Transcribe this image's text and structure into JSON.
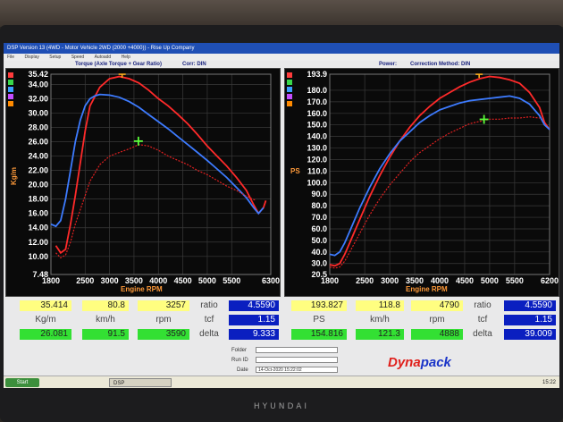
{
  "window": {
    "title": "DSP Version 13 (4WD - Motor Vehicle 2WD (2000 +4000)) - Rise Up Company",
    "menu": [
      "File",
      "Display",
      "Setup",
      "Speed",
      "Autoadd",
      "Help"
    ]
  },
  "colors": {
    "run1": "#ff2a2a",
    "run2": "#3d7bff",
    "run3": "#e02020",
    "marker": "#5cff3a",
    "peak_marker": "#ffb020",
    "value_yellow": "#fffe80",
    "value_green": "#33e033",
    "value_blue": "#0a1fc0",
    "dynapack_red": "#e0201c",
    "dynapack_blue": "#1a34c8"
  },
  "left_panel": {
    "header": "Torque (Axle Torque + Gear Ratio)",
    "correction": "Corr: DIN",
    "ylabel": "Kg/m",
    "xlabel": "Engine RPM",
    "swatch_colors": [
      "#ff3c3c",
      "#38d84a",
      "#3aa0ff",
      "#c44dff",
      "#ff8a00"
    ]
  },
  "right_panel": {
    "header": "Power:",
    "correction": "Correction Method: DIN",
    "ylabel": "PS",
    "xlabel": "Engine RPM",
    "swatch_colors": [
      "#ff3c3c",
      "#38d84a",
      "#3aa0ff",
      "#c44dff",
      "#ff8a00"
    ]
  },
  "chart_data": [
    {
      "type": "line",
      "title": "Torque (Axle Torque + Gear Ratio)",
      "xlabel": "Engine RPM",
      "ylabel": "Kg/m",
      "xlim": [
        1800,
        6300
      ],
      "ylim": [
        7.48,
        35.42
      ],
      "x_ticks": [
        "1800",
        "2500",
        "3000",
        "3500",
        "4000",
        "4500",
        "5000",
        "5500",
        "6300"
      ],
      "y_ticks": [
        "35.42",
        "34.00",
        "32.00",
        "30.00",
        "28.00",
        "26.00",
        "24.00",
        "22.00",
        "20.00",
        "18.00",
        "16.00",
        "14.00",
        "12.00",
        "10.00",
        "7.48"
      ],
      "grid": true,
      "series": [
        {
          "color": "#ff2a2a",
          "x": [
            1900,
            2000,
            2100,
            2200,
            2300,
            2400,
            2500,
            2600,
            2800,
            3000,
            3200,
            3400,
            3600,
            3800,
            4000,
            4200,
            4400,
            4600,
            4800,
            5000,
            5200,
            5400,
            5600,
            5800,
            5950,
            6050,
            6150,
            6200
          ],
          "y": [
            11.5,
            10.5,
            11.0,
            14.5,
            18.5,
            23.0,
            27.5,
            31.0,
            33.6,
            34.8,
            35.1,
            34.8,
            34.2,
            33.2,
            32.0,
            31.0,
            29.8,
            28.5,
            27.0,
            25.4,
            24.0,
            22.6,
            21.0,
            19.2,
            17.2,
            16.0,
            16.8,
            17.8
          ]
        },
        {
          "color": "#3d7bff",
          "x": [
            1800,
            1900,
            2000,
            2100,
            2200,
            2300,
            2400,
            2500,
            2600,
            2700,
            2800,
            3000,
            3200,
            3400,
            3600,
            3800,
            4000,
            4200,
            4400,
            4600,
            4800,
            5000,
            5200,
            5400,
            5600,
            5800,
            5950,
            6050,
            6150
          ],
          "y": [
            14.5,
            14.2,
            15.0,
            18.0,
            22.0,
            26.0,
            29.0,
            31.0,
            32.0,
            32.4,
            32.6,
            32.5,
            32.2,
            31.6,
            30.8,
            29.8,
            28.8,
            27.8,
            26.7,
            25.6,
            24.5,
            23.4,
            22.2,
            21.0,
            19.6,
            18.2,
            16.8,
            16.0,
            16.8
          ]
        },
        {
          "color": "#e02020",
          "x": [
            1900,
            2000,
            2100,
            2200,
            2300,
            2400,
            2500,
            2600,
            2800,
            3000,
            3200,
            3400,
            3600,
            3800,
            4000,
            4200,
            4400,
            4600,
            4800,
            5000,
            5200,
            5400,
            5600,
            5800,
            6000
          ],
          "y": [
            10.5,
            9.8,
            10.2,
            12.0,
            14.5,
            16.5,
            18.5,
            20.5,
            22.8,
            24.0,
            24.5,
            25.0,
            25.6,
            25.4,
            24.8,
            24.0,
            23.4,
            22.8,
            22.0,
            21.4,
            20.6,
            19.8,
            19.2,
            18.4,
            17.8
          ]
        }
      ],
      "markers": [
        {
          "kind": "cross",
          "x": 3590,
          "y": 26.081,
          "color": "#5cff3a"
        },
        {
          "kind": "peak",
          "x": 3257,
          "y": 35.414,
          "color": "#ffb020"
        }
      ]
    },
    {
      "type": "line",
      "title": "Power:",
      "xlabel": "Engine RPM",
      "ylabel": "PS",
      "xlim": [
        1800,
        6200
      ],
      "ylim": [
        20.5,
        193.9
      ],
      "x_ticks": [
        "1800",
        "2500",
        "3000",
        "3500",
        "4000",
        "4500",
        "5000",
        "5500",
        "6200"
      ],
      "y_ticks": [
        "193.9",
        "180.0",
        "170.0",
        "160.0",
        "150.0",
        "140.0",
        "130.0",
        "120.0",
        "110.0",
        "100.0",
        "90.0",
        "80.0",
        "70.0",
        "60.0",
        "50.0",
        "40.0",
        "30.0",
        "20.5"
      ],
      "grid": true,
      "series": [
        {
          "color": "#ff2a2a",
          "x": [
            1800,
            1900,
            2000,
            2100,
            2200,
            2400,
            2600,
            2800,
            3000,
            3200,
            3400,
            3600,
            3800,
            4000,
            4200,
            4400,
            4600,
            4800,
            5000,
            5200,
            5400,
            5600,
            5800,
            6000,
            6100,
            6200
          ],
          "y": [
            29,
            28,
            30,
            38,
            48,
            68,
            88,
            106,
            122,
            136,
            148,
            158,
            166,
            173,
            178,
            183,
            187,
            190,
            192,
            191,
            189,
            186,
            178,
            165,
            152,
            146
          ]
        },
        {
          "color": "#3d7bff",
          "x": [
            1800,
            1900,
            2000,
            2100,
            2200,
            2400,
            2600,
            2800,
            3000,
            3200,
            3400,
            3600,
            3800,
            4000,
            4200,
            4400,
            4600,
            4800,
            5000,
            5200,
            5400,
            5600,
            5800,
            6000,
            6100,
            6200
          ],
          "y": [
            38,
            37,
            40,
            48,
            58,
            78,
            96,
            112,
            125,
            136,
            144,
            152,
            158,
            163,
            166,
            169,
            171,
            172,
            173,
            174,
            175,
            173,
            168,
            158,
            150,
            146
          ]
        },
        {
          "color": "#e02020",
          "x": [
            1800,
            1900,
            2000,
            2100,
            2200,
            2400,
            2600,
            2800,
            3000,
            3200,
            3400,
            3600,
            3800,
            4000,
            4200,
            4400,
            4600,
            4800,
            5000,
            5200,
            5400,
            5600,
            5800,
            6000
          ],
          "y": [
            27,
            26,
            27,
            32,
            40,
            56,
            72,
            86,
            98,
            108,
            118,
            126,
            132,
            138,
            143,
            147,
            151,
            153,
            155,
            155,
            156,
            156,
            157,
            156
          ]
        }
      ],
      "markers": [
        {
          "kind": "cross",
          "x": 4888,
          "y": 154.816,
          "color": "#5cff3a"
        },
        {
          "kind": "peak",
          "x": 4790,
          "y": 193.827,
          "color": "#ffb020"
        }
      ]
    }
  ],
  "readouts": {
    "left": {
      "row1": {
        "value": "35.414",
        "speed": "80.8",
        "rpm": "3257",
        "ratio_label": "ratio",
        "ratio": "4.5590"
      },
      "labels": {
        "unit": "Kg/m",
        "speed": "km/h",
        "rpm": "rpm",
        "tcf_label": "tcf",
        "tcf": "1.15"
      },
      "row3": {
        "value": "26.081",
        "speed": "91.5",
        "rpm": "3590",
        "delta_label": "delta",
        "delta": "9.333"
      }
    },
    "right": {
      "row1": {
        "value": "193.827",
        "speed": "118.8",
        "rpm": "4790",
        "ratio_label": "ratio",
        "ratio": "4.5590"
      },
      "labels": {
        "unit": "PS",
        "speed": "km/h",
        "rpm": "rpm",
        "tcf_label": "tcf",
        "tcf": "1.15"
      },
      "row3": {
        "value": "154.816",
        "speed": "121.3",
        "rpm": "4888",
        "delta_label": "delta",
        "delta": "39.009"
      }
    }
  },
  "info": {
    "folder_label": "Folder",
    "run_label": "Run ID",
    "date_label": "Date",
    "date_value": "14-Oct-2020 15:22:02"
  },
  "logo": {
    "part1": "Dyna",
    "part2": "pack"
  },
  "taskbar": {
    "start": "Start",
    "app": "DSP",
    "clock": "15:22"
  },
  "monitor_brand": "HYUNDAI"
}
